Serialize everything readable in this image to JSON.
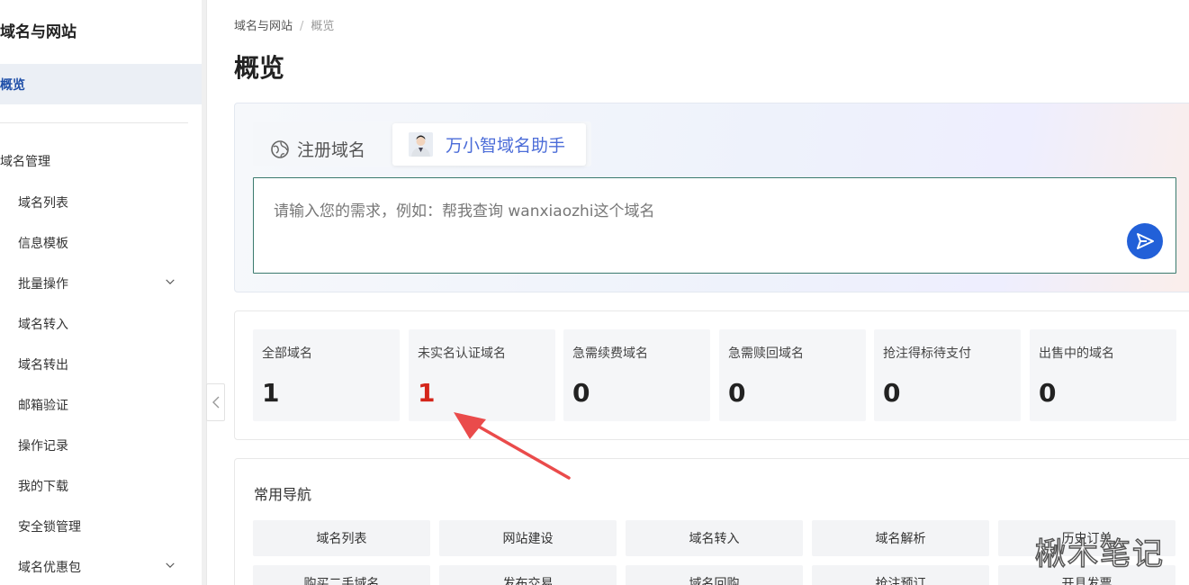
{
  "sidebar": {
    "title": "域名与网站",
    "active_item": "概览",
    "group_label": "域名管理",
    "items": [
      {
        "label": "域名列表",
        "has_chevron": false
      },
      {
        "label": "信息模板",
        "has_chevron": false
      },
      {
        "label": "批量操作",
        "has_chevron": true
      },
      {
        "label": "域名转入",
        "has_chevron": false
      },
      {
        "label": "域名转出",
        "has_chevron": false
      },
      {
        "label": "邮箱验证",
        "has_chevron": false
      },
      {
        "label": "操作记录",
        "has_chevron": false
      },
      {
        "label": "我的下载",
        "has_chevron": false
      },
      {
        "label": "安全锁管理",
        "has_chevron": false
      },
      {
        "label": "域名优惠包",
        "has_chevron": true
      }
    ]
  },
  "breadcrumb": {
    "parent": "域名与网站",
    "separator": "/",
    "current": "概览"
  },
  "page_title": "概览",
  "assistant": {
    "tab_register": "注册域名",
    "tab_ai": "万小智域名助手",
    "input_placeholder": "请输入您的需求，例如：帮我查询 wanxiaozhi这个域名"
  },
  "stats": [
    {
      "label": "全部域名",
      "value": "1",
      "highlight": false
    },
    {
      "label": "未实名认证域名",
      "value": "1",
      "highlight": true
    },
    {
      "label": "急需续费域名",
      "value": "0",
      "highlight": false
    },
    {
      "label": "急需赎回域名",
      "value": "0",
      "highlight": false
    },
    {
      "label": "抢注得标待支付",
      "value": "0",
      "highlight": false
    },
    {
      "label": "出售中的域名",
      "value": "0",
      "highlight": false
    }
  ],
  "common_nav": {
    "title": "常用导航",
    "row1": [
      "域名列表",
      "网站建设",
      "域名转入",
      "域名解析",
      "历史订单"
    ],
    "row2": [
      "购买二手域名",
      "发布交易",
      "域名回购",
      "抢注预订",
      "开具发票"
    ]
  },
  "watermark": "楸木笔记",
  "colors": {
    "accent": "#1f4fa8",
    "highlight_red": "#d4261b",
    "send_button": "#2260d8",
    "annotation_arrow": "#e84a4a"
  }
}
